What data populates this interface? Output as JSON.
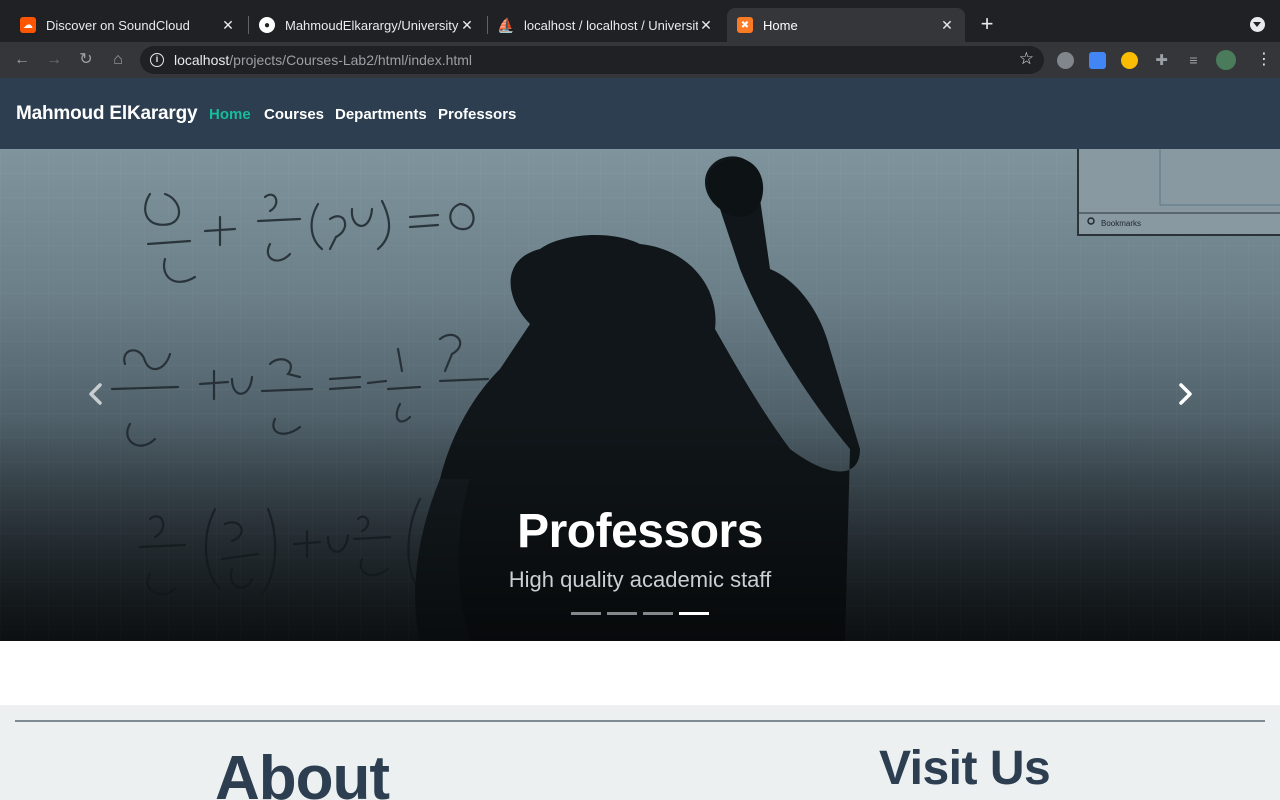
{
  "browser": {
    "tabs": [
      {
        "title": "Discover on SoundCloud",
        "favicon": "soundcloud-icon",
        "active": false
      },
      {
        "title": "MahmoudElkarargy/University-",
        "favicon": "github-icon",
        "active": false
      },
      {
        "title": "localhost / localhost / Universit",
        "favicon": "phpmyadmin-icon",
        "active": false
      },
      {
        "title": "Home",
        "favicon": "xampp-icon",
        "active": true
      }
    ],
    "url_host": "localhost",
    "url_path": "/projects/Courses-Lab2/html/index.html"
  },
  "site": {
    "brand": "Mahmoud ElKarargy",
    "nav": [
      {
        "label": "Home",
        "active": true
      },
      {
        "label": "Courses",
        "active": false
      },
      {
        "label": "Departments",
        "active": false
      },
      {
        "label": "Professors",
        "active": false
      }
    ],
    "accent_color": "#18bc9c",
    "navbar_color": "#2c3e50"
  },
  "carousel": {
    "title": "Professors",
    "subtitle": "High quality academic staff",
    "slide_count": 4,
    "active_index": 3,
    "background_image": "teacher silhouette writing fluid dynamics equations on whiteboard"
  },
  "sections": {
    "about_heading": "About",
    "visit_heading": "Visit Us"
  }
}
